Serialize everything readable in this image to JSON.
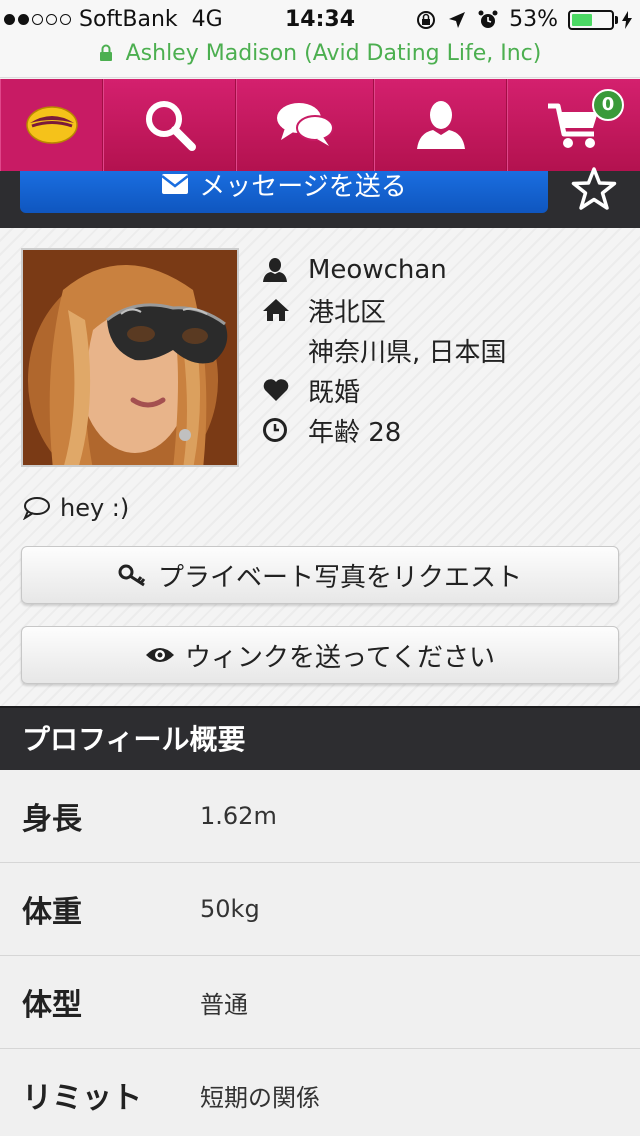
{
  "statusbar": {
    "carrier": "SoftBank",
    "network": "4G",
    "time": "14:34",
    "battery": "53%",
    "battery_level": 0.53,
    "signal_bars_filled": 2,
    "signal_bars_total": 5
  },
  "urlbar": {
    "title": "Ashley Madison (Avid Dating Life, Inc)"
  },
  "nav": {
    "items": [
      "logo-icon",
      "search-icon",
      "chat-icon",
      "user-icon",
      "cart-icon"
    ],
    "cart_count": "0"
  },
  "actions": {
    "message_button": "メッセージを送る"
  },
  "profile": {
    "username": "Meowchan",
    "location_ward": "港北区",
    "location_region": "神奈川県, 日本国",
    "marital": "既婚",
    "age": "年齢 28",
    "status_message": "hey :)",
    "request_private_photo": "プライベート写真をリクエスト",
    "send_wink": "ウィンクを送ってください"
  },
  "overview": {
    "title": "プロフィール概要",
    "rows": [
      {
        "label": "身長",
        "value": "1.62m"
      },
      {
        "label": "体重",
        "value": "50kg"
      },
      {
        "label": "体型",
        "value": "普通"
      },
      {
        "label": "リミット",
        "value": "短期の関係"
      }
    ]
  },
  "colors": {
    "nav_pink": "#c81b64",
    "button_blue": "#1a6ee0",
    "url_green": "#4caf50",
    "badge_green": "#3a9a3a"
  }
}
